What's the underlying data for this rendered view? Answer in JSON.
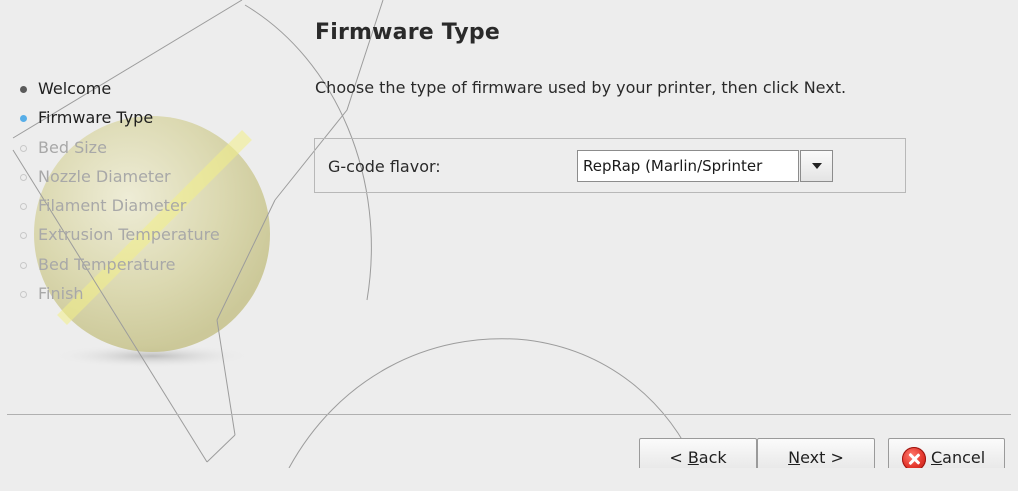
{
  "wizard": {
    "title": "Firmware Type",
    "instructions": "Choose the type of firmware used by your printer, then click Next.",
    "steps": [
      {
        "label": "Welcome",
        "state": "done"
      },
      {
        "label": "Firmware Type",
        "state": "current"
      },
      {
        "label": "Bed Size",
        "state": "pending"
      },
      {
        "label": "Nozzle Diameter",
        "state": "pending"
      },
      {
        "label": "Filament Diameter",
        "state": "pending"
      },
      {
        "label": "Extrusion Temperature",
        "state": "pending"
      },
      {
        "label": "Bed Temperature",
        "state": "pending"
      },
      {
        "label": "Finish",
        "state": "pending"
      }
    ],
    "gcode_flavor": {
      "label": "G-code flavor:",
      "value": "RepRap (Marlin/Sprinter"
    }
  },
  "buttons": {
    "back": {
      "prefix": "< ",
      "mnemonic": "B",
      "rest": "ack"
    },
    "next": {
      "mnemonic": "N",
      "rest": "ext >"
    },
    "cancel": {
      "mnemonic": "C",
      "rest": "ancel"
    }
  },
  "icons": {
    "cancel": "cancel-icon",
    "dropdown": "chevron-down-icon",
    "step_marker": "bullet-icon"
  },
  "colors": {
    "current_step": "#57aee8",
    "pending_step": "#a8a8a8",
    "cancel_icon": "#e3352b"
  }
}
